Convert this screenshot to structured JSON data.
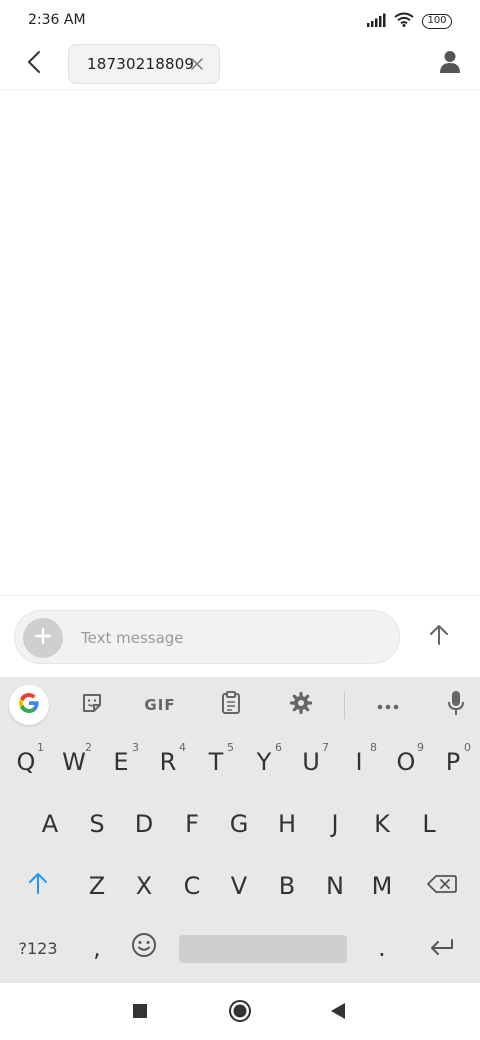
{
  "status_bar": {
    "time": "2:36 AM",
    "battery_level": "100",
    "icons": [
      "signal-icon",
      "wifi-icon",
      "battery-icon"
    ]
  },
  "header": {
    "back_icon": "back-arrow-icon",
    "recipient": "18730218809",
    "remove_icon": "close-icon",
    "contact_icon": "person-icon"
  },
  "compose": {
    "placeholder": "Text message",
    "value": "",
    "add_icon": "plus-icon",
    "send_icon": "arrow-up-icon"
  },
  "keyboard": {
    "toolbar": {
      "items": [
        "google-icon",
        "sticker-icon",
        "GIF",
        "clipboard-icon",
        "gear-icon",
        "more-icon",
        "microphone-icon"
      ]
    },
    "row1": [
      {
        "label": "Q",
        "hint": "1"
      },
      {
        "label": "W",
        "hint": "2"
      },
      {
        "label": "E",
        "hint": "3"
      },
      {
        "label": "R",
        "hint": "4"
      },
      {
        "label": "T",
        "hint": "5"
      },
      {
        "label": "Y",
        "hint": "6"
      },
      {
        "label": "U",
        "hint": "7"
      },
      {
        "label": "I",
        "hint": "8"
      },
      {
        "label": "O",
        "hint": "9"
      },
      {
        "label": "P",
        "hint": "0"
      }
    ],
    "row2": [
      "A",
      "S",
      "D",
      "F",
      "G",
      "H",
      "J",
      "K",
      "L"
    ],
    "row3": [
      "Z",
      "X",
      "C",
      "V",
      "B",
      "N",
      "M"
    ],
    "symbols_label": "?123",
    "comma_label": ",",
    "period_label": ".",
    "accent_color": "#2196f3"
  },
  "nav_bar": {
    "icons": [
      "recents-square-icon",
      "home-circle-icon",
      "back-triangle-icon"
    ]
  }
}
